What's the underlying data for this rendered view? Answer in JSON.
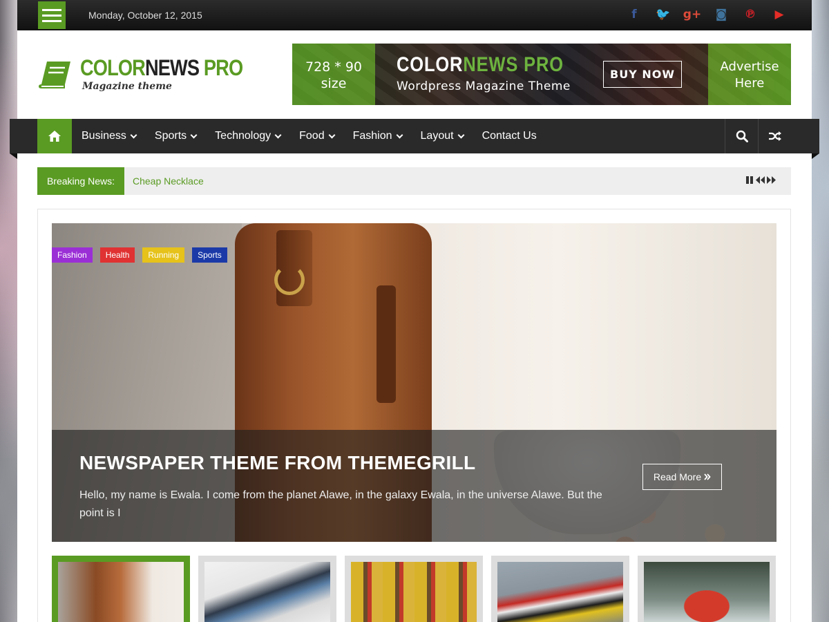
{
  "topbar": {
    "date": "Monday, October 12, 2015",
    "social": [
      {
        "icon": "facebook-icon",
        "glyph": "f",
        "color": "#3b5998"
      },
      {
        "icon": "twitter-icon",
        "glyph": "🐦",
        "color": "#1da1f2"
      },
      {
        "icon": "google-plus-icon",
        "glyph": "g+",
        "color": "#dd4b39"
      },
      {
        "icon": "instagram-icon",
        "glyph": "◙",
        "color": "#3f729b"
      },
      {
        "icon": "pinterest-icon",
        "glyph": "℗",
        "color": "#cb2027"
      },
      {
        "icon": "youtube-icon",
        "glyph": "▶",
        "color": "#e52d27"
      }
    ]
  },
  "logo": {
    "title_green": "COLOR",
    "title_dark": "NEWS",
    "title_green2": "PRO",
    "tagline": "Magazine theme",
    "accent": "#5a9b23"
  },
  "ad": {
    "size_line1": "728 * 90",
    "size_line2": "size",
    "brand_white": "COLOR",
    "brand_green": "NEWS PRO",
    "subtitle": "Wordpress Magazine Theme",
    "buy_label": "BUY NOW",
    "advertise_line1": "Advertise",
    "advertise_line2": "Here"
  },
  "nav": {
    "items": [
      {
        "label": "Business",
        "dropdown": true
      },
      {
        "label": "Sports",
        "dropdown": true
      },
      {
        "label": "Technology",
        "dropdown": true
      },
      {
        "label": "Food",
        "dropdown": true
      },
      {
        "label": "Fashion",
        "dropdown": true
      },
      {
        "label": "Layout",
        "dropdown": true
      },
      {
        "label": "Contact Us",
        "dropdown": false
      }
    ]
  },
  "breaking": {
    "label": "Breaking News:",
    "headline": "Cheap Necklace"
  },
  "slider": {
    "tags": [
      {
        "label": "Fashion",
        "color": "#9b2fd6"
      },
      {
        "label": "Health",
        "color": "#e03232"
      },
      {
        "label": "Running",
        "color": "#e6c21a"
      },
      {
        "label": "Sports",
        "color": "#1b3aa8"
      }
    ],
    "title": "NEWSPAPER THEME FROM THEMEGRILL",
    "excerpt": "Hello, my name is Ewala. I come from the planet Alawe, in the galaxy Ewala, in the universe Alawe. But the point is I",
    "read_more": "Read More",
    "read_more_icon": "double-chevron-right-icon"
  }
}
